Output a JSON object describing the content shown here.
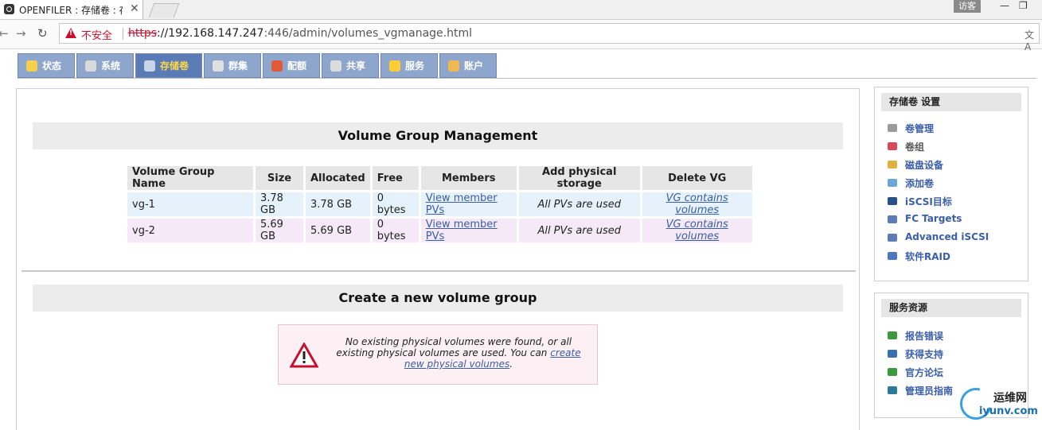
{
  "browser": {
    "tab_title": "OPENFILER : 存储卷 : 存",
    "guest_label": "访客",
    "insecure_label": "不安全",
    "url_scheme": "https",
    "url_host": "://192.168.147.247",
    "url_rest": ":446/admin/volumes_vgmanage.html"
  },
  "nav": {
    "tabs": [
      {
        "label": "状态",
        "icon": "status-icon"
      },
      {
        "label": "系统",
        "icon": "system-icon"
      },
      {
        "label": "存储卷",
        "icon": "volumes-icon",
        "active": true
      },
      {
        "label": "群集",
        "icon": "cluster-icon"
      },
      {
        "label": "配额",
        "icon": "quota-icon"
      },
      {
        "label": "共享",
        "icon": "shares-icon"
      },
      {
        "label": "服务",
        "icon": "services-icon"
      },
      {
        "label": "账户",
        "icon": "accounts-icon"
      }
    ]
  },
  "main": {
    "vg_section_title": "Volume Group Management",
    "table": {
      "headers": [
        "Volume Group Name",
        "Size",
        "Allocated",
        "Free",
        "Members",
        "Add physical storage",
        "Delete VG"
      ],
      "rows": [
        {
          "name": "vg-1",
          "size": "3.78 GB",
          "allocated": "3.78 GB",
          "free": "0 bytes",
          "members": "View member PVs",
          "add": "All PVs are used",
          "delete": "VG contains volumes"
        },
        {
          "name": "vg-2",
          "size": "5.69 GB",
          "allocated": "5.69 GB",
          "free": "0 bytes",
          "members": "View member PVs",
          "add": "All PVs are used",
          "delete": "VG contains volumes"
        }
      ]
    },
    "create_section_title": "Create a new volume group",
    "notice": {
      "text": "No existing physical volumes were found, or all existing physical volumes are used. You can ",
      "link1": "create",
      "link2": "new physical volumes",
      "end": "."
    }
  },
  "sidebar": {
    "settings": {
      "title": "存储卷 设置",
      "items": [
        {
          "label": "卷管理",
          "icon": "volume-manage-icon"
        },
        {
          "label": "卷组",
          "icon": "volume-group-icon"
        },
        {
          "label": "磁盘设备",
          "icon": "disk-icon"
        },
        {
          "label": "添加卷",
          "icon": "add-volume-icon"
        },
        {
          "label": "iSCSI目标",
          "icon": "iscsi-icon"
        },
        {
          "label": "FC Targets",
          "icon": "fc-icon"
        },
        {
          "label": "Advanced iSCSI",
          "icon": "advanced-iscsi-icon"
        },
        {
          "label": "软件RAID",
          "icon": "raid-icon"
        }
      ]
    },
    "resources": {
      "title": "服务资源",
      "items": [
        {
          "label": "报告错误",
          "icon": "bug-icon"
        },
        {
          "label": "获得支持",
          "icon": "support-icon"
        },
        {
          "label": "官方论坛",
          "icon": "forum-icon"
        },
        {
          "label": "管理员指南",
          "icon": "guide-icon"
        }
      ]
    }
  },
  "watermark": {
    "line1": "运维网",
    "line2": "iyunv.com"
  },
  "colors": {
    "nav_tab": "#8ea6cc",
    "nav_active": "#5a7bb5",
    "link": "#3a5ea7",
    "warn": "#c8102e"
  }
}
